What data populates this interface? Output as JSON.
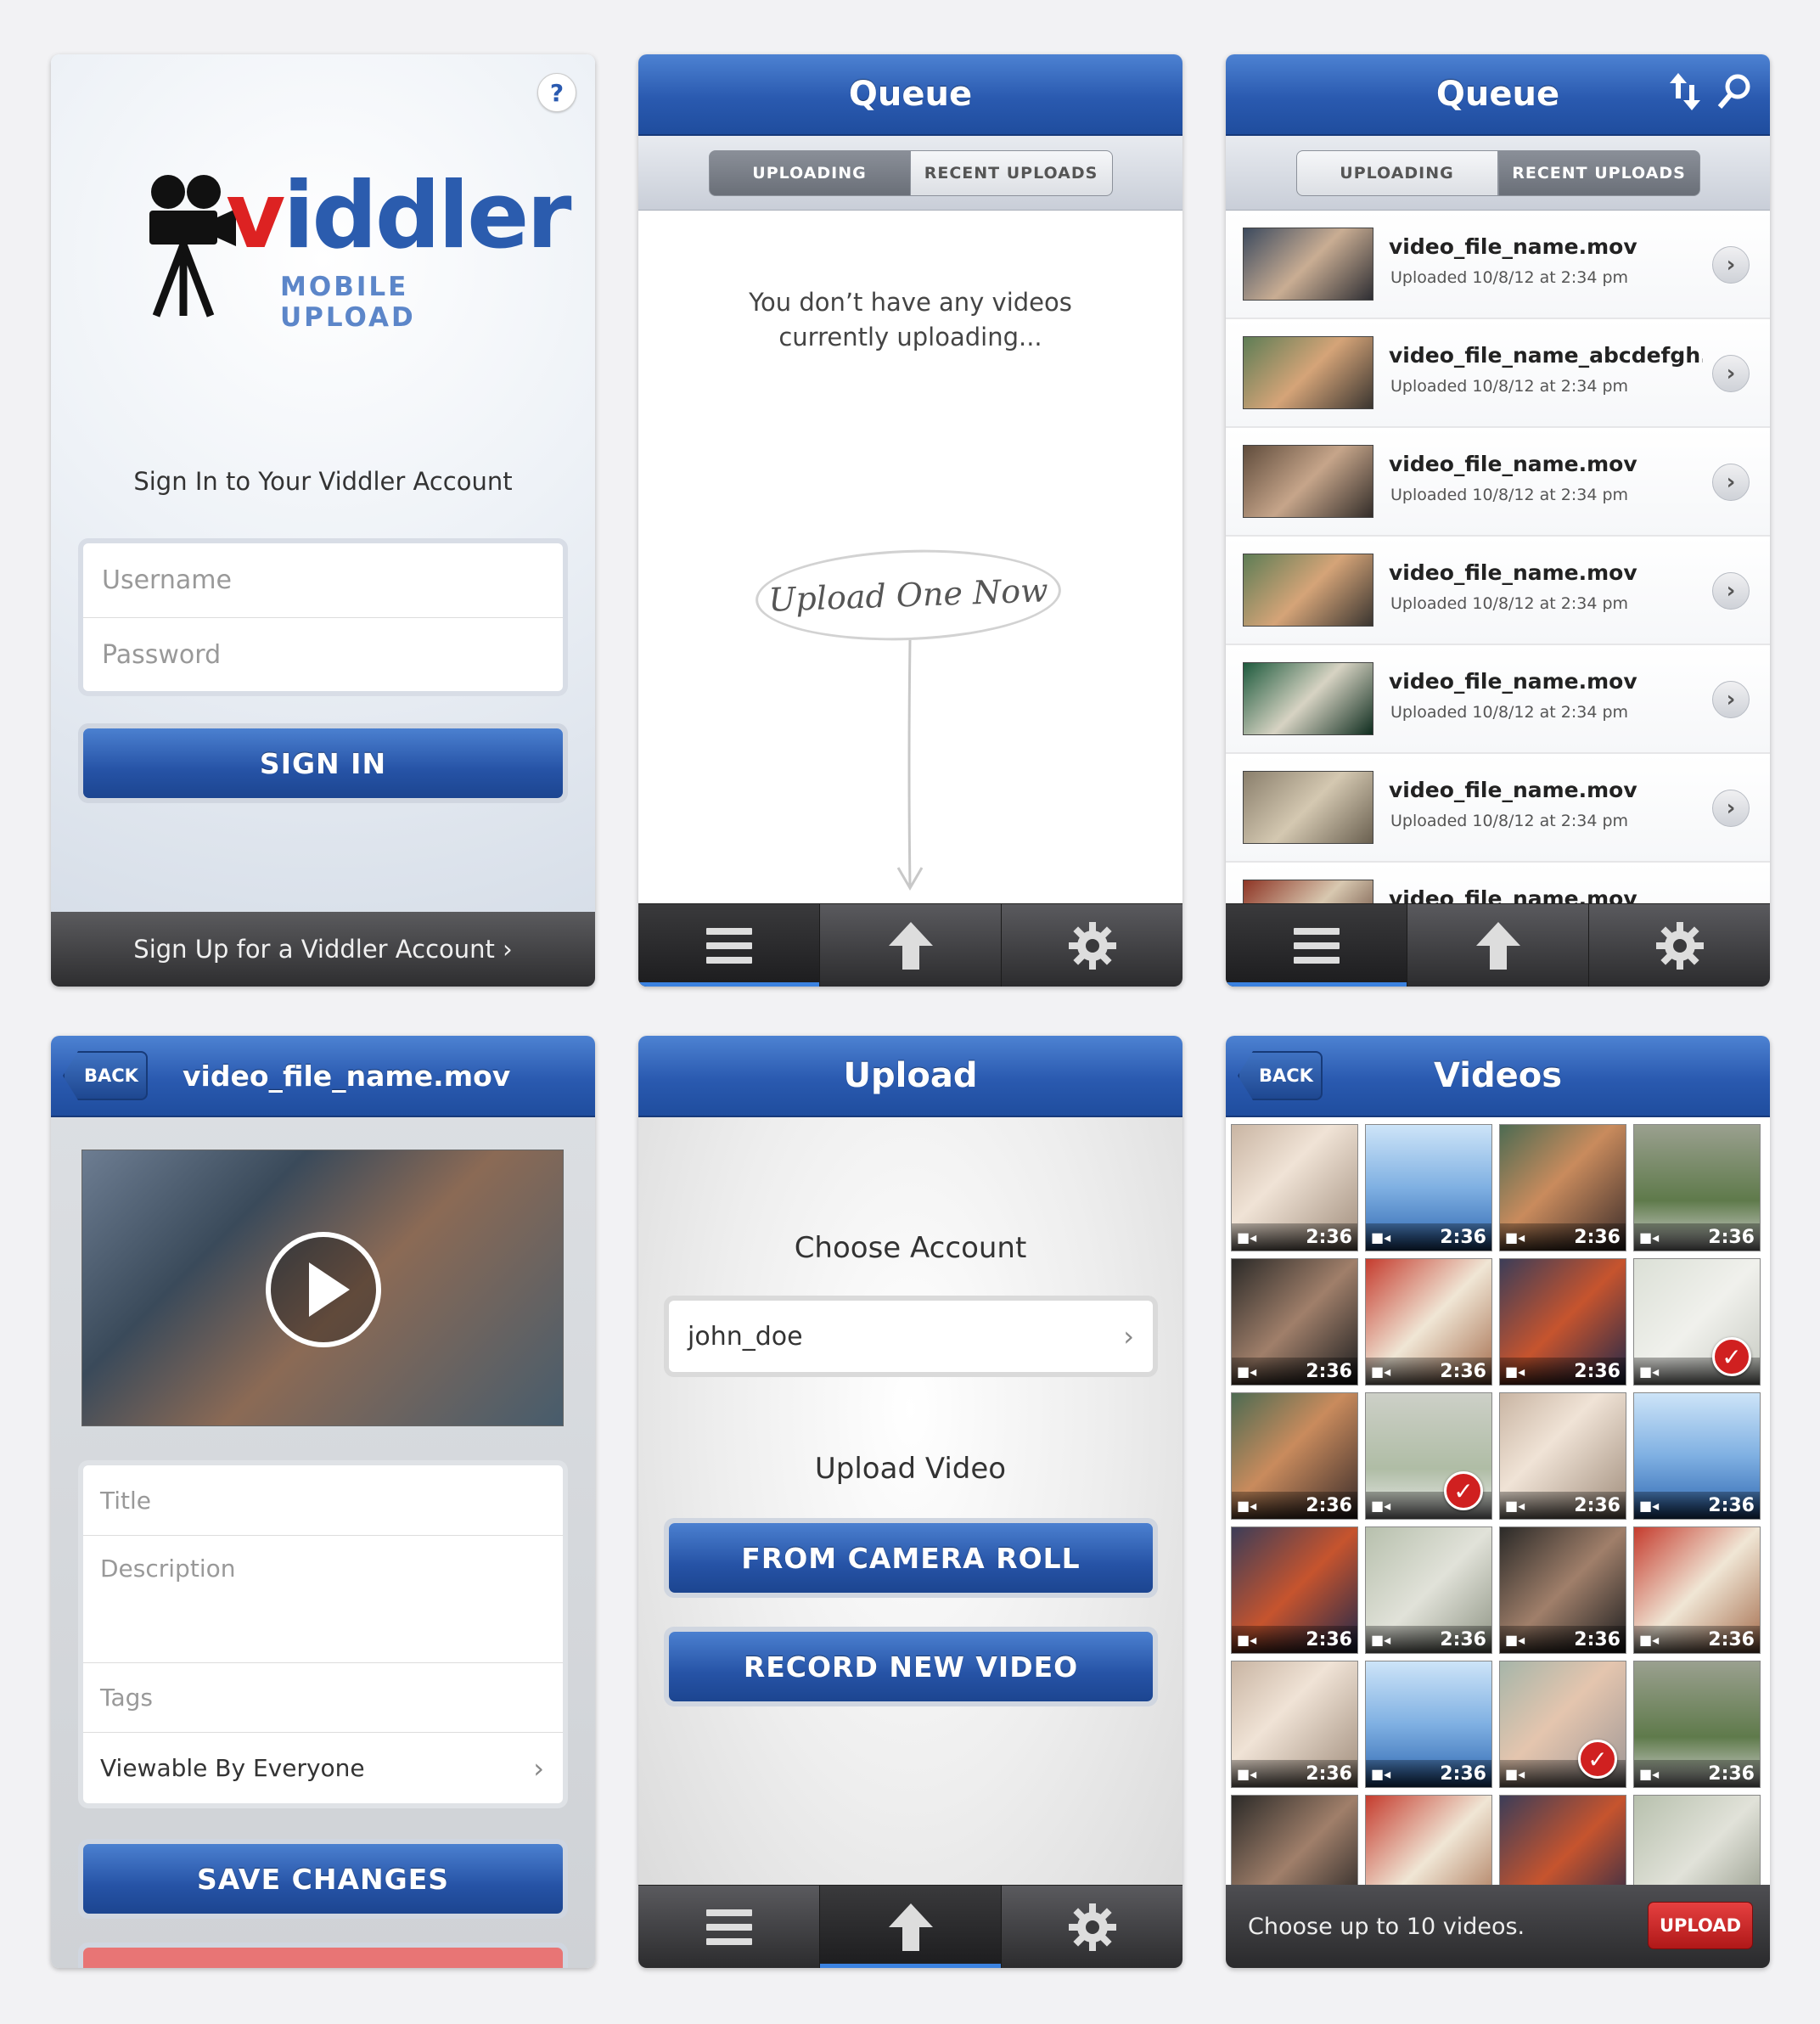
{
  "signin": {
    "help": "?",
    "logo_word_first": "v",
    "logo_word_rest": "iddler",
    "logo_sub": "MOBILE UPLOAD",
    "heading": "Sign In to Your Viddler Account",
    "username_placeholder": "Username",
    "password_placeholder": "Password",
    "signin_button": "SIGN IN",
    "signup_link": "Sign Up for a Viddler Account  ›"
  },
  "queue_empty": {
    "title": "Queue",
    "tabs": [
      "UPLOADING",
      "RECENT UPLOADS"
    ],
    "active_tab": "UPLOADING",
    "empty_line1": "You don’t have any videos",
    "empty_line2": "currently uploading...",
    "upload_one_now": "Upload One Now"
  },
  "queue_recent": {
    "title": "Queue",
    "tabs": [
      "UPLOADING",
      "RECENT UPLOADS"
    ],
    "active_tab": "RECENT UPLOADS",
    "items": [
      {
        "name": "video_file_name.mov",
        "uploaded": "Uploaded 10/8/12 at 2:34 pm"
      },
      {
        "name": "video_file_name_abcdefgh...",
        "uploaded": "Uploaded 10/8/12 at 2:34 pm"
      },
      {
        "name": "video_file_name.mov",
        "uploaded": "Uploaded 10/8/12 at 2:34 pm"
      },
      {
        "name": "video_file_name.mov",
        "uploaded": "Uploaded 10/8/12 at 2:34 pm"
      },
      {
        "name": "video_file_name.mov",
        "uploaded": "Uploaded 10/8/12 at 2:34 pm"
      },
      {
        "name": "video_file_name.mov",
        "uploaded": "Uploaded 10/8/12 at 2:34 pm"
      },
      {
        "name": "video_file_name.mov",
        "uploaded": ""
      }
    ]
  },
  "video_detail": {
    "back": "BACK",
    "title": "video_file_name.mov",
    "title_placeholder": "Title",
    "description_placeholder": "Description",
    "tags_placeholder": "Tags",
    "privacy": "Viewable By Everyone",
    "save_button": "SAVE CHANGES"
  },
  "upload": {
    "title": "Upload",
    "choose_account": "Choose Account",
    "account": "john_doe",
    "upload_video": "Upload Video",
    "from_camera_roll": "FROM CAMERA ROLL",
    "record_new": "RECORD NEW VIDEO"
  },
  "videos": {
    "back": "BACK",
    "title": "Videos",
    "duration": "2:36",
    "hint": "Choose up to 10 videos.",
    "upload_button": "UPLOAD"
  },
  "icons": {
    "menu": "menu-icon",
    "upload": "upload-arrow-icon",
    "settings": "gear-icon",
    "sort": "sort-arrows-icon",
    "search": "search-icon",
    "chevron": "chevron-right-icon",
    "play": "play-icon",
    "check": "checkmark-icon",
    "camera": "video-camera-icon"
  },
  "colors": {
    "nav_blue": "#2a5ab0",
    "tab_active_indicator": "#3b82e0",
    "upload_red": "#c82020"
  }
}
